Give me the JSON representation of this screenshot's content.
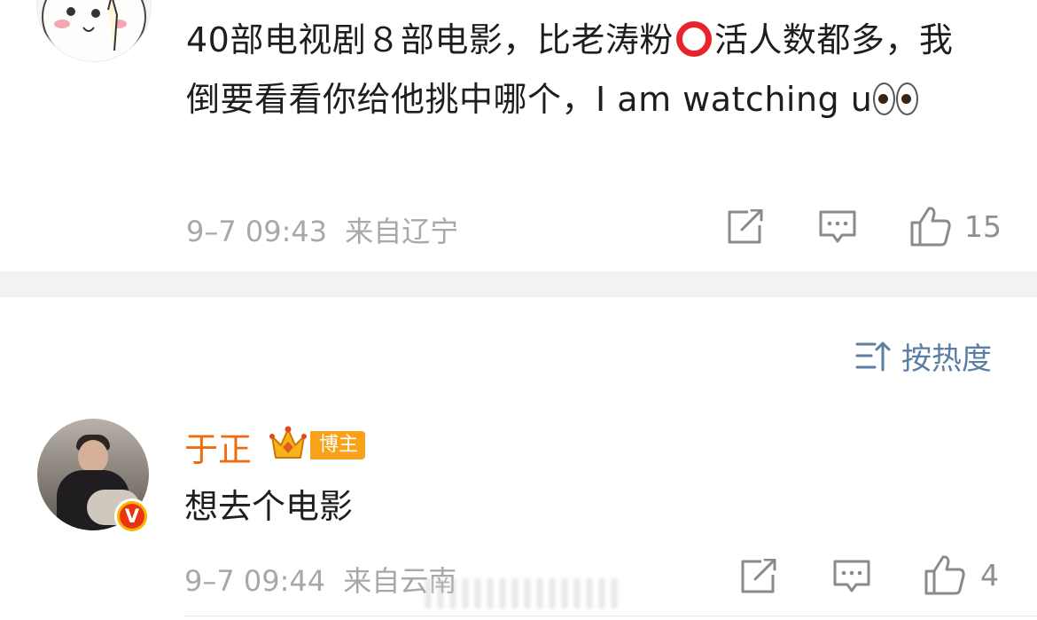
{
  "comment1": {
    "avatar_icon": "cartoon-avatar",
    "text_part1": "40部电视剧８部电影，比老涛粉",
    "circle_emoji": "red-circle-emoji",
    "text_part2": "活人数都多，我倒要看看你给他挑中哪个，I am watching u",
    "eyes_emoji": "eyes-emoji",
    "time": "9–7 09:43",
    "location": "来自辽宁",
    "like_count": "15"
  },
  "sort": {
    "label": "按热度",
    "icon": "sort-icon"
  },
  "comment2": {
    "username": "于正",
    "tag": "博主",
    "verified_badge": "V",
    "text": "想去个电影",
    "time": "9–7 09:44",
    "location": "来自云南",
    "like_count": "4"
  },
  "colors": {
    "username": "#f16b0d",
    "link_blue": "#5b7ea5",
    "meta_gray": "#a8a8a8",
    "tag_orange": "#f8a11a",
    "verified_red": "#e8350f"
  }
}
